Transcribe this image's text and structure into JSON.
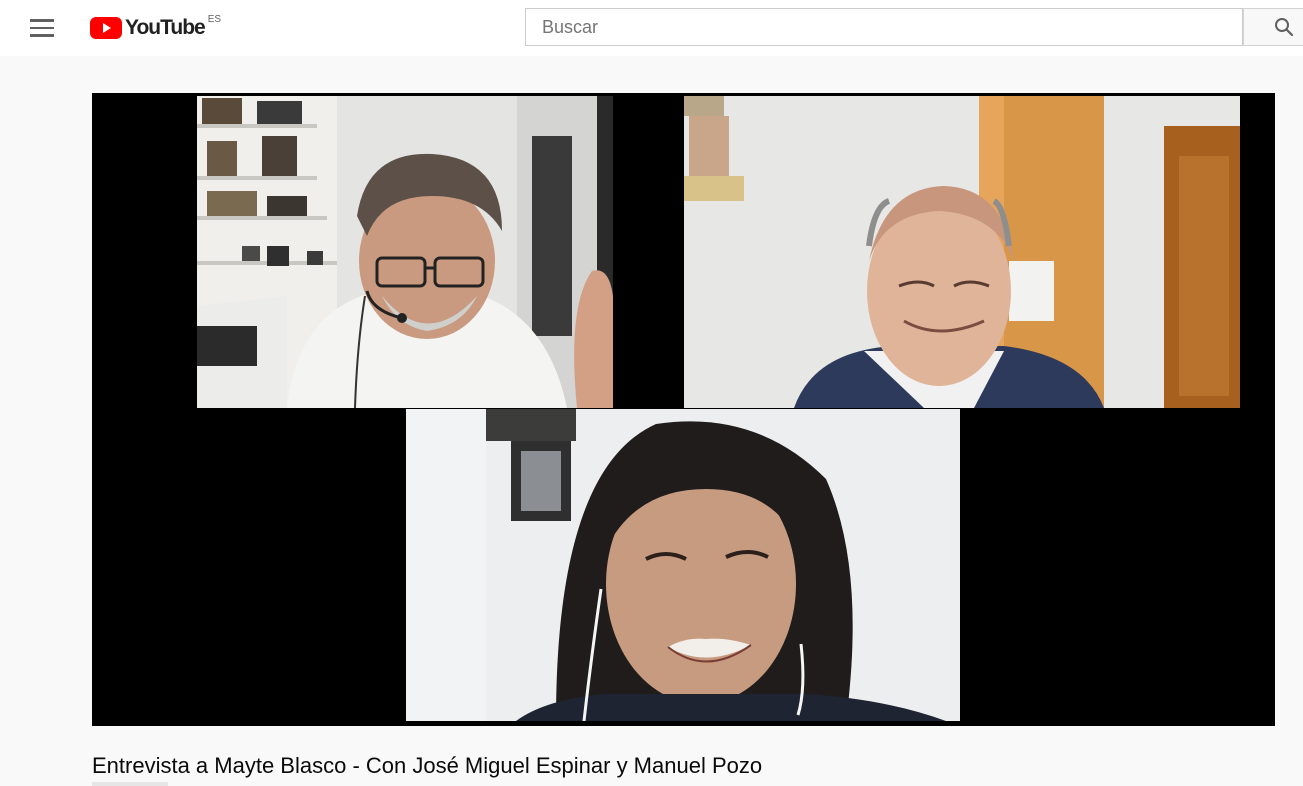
{
  "header": {
    "logo_text": "YouTube",
    "country_code": "ES",
    "search_placeholder": "Buscar",
    "icons": [
      "menu-icon",
      "youtube-logo-icon",
      "search-icon"
    ]
  },
  "video": {
    "title": "Entrevista a Mayte Blasco - Con José Miguel Espinar y Manuel Pozo",
    "participants": [
      "participant-man-headset",
      "participant-man-bald",
      "participant-woman"
    ]
  },
  "colors": {
    "brand_red": "#ff0000",
    "page_background": "#f9f9f9",
    "player_background": "#000000"
  }
}
